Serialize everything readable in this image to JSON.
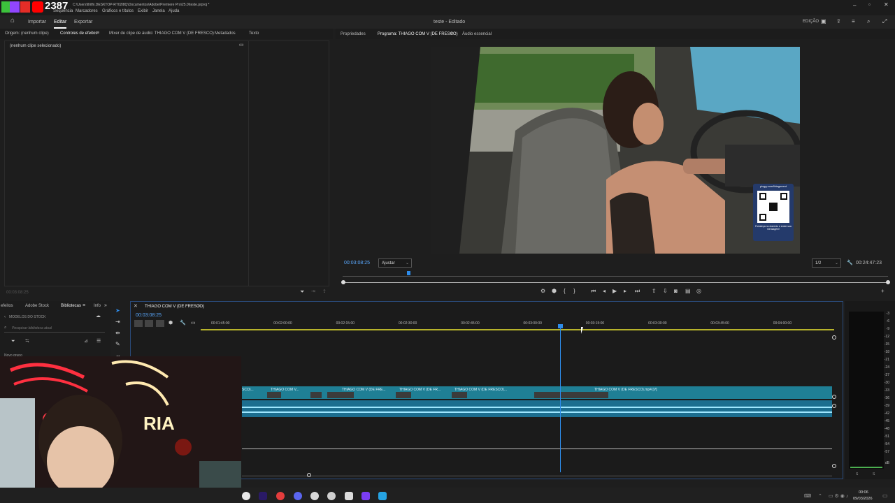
{
  "titlebar": {
    "stream_count": "2387",
    "path": "C:\\Users\\thithi.DESKTOP-RT02I8Q\\Documentos\\Adobe\\Premiere Pro\\25.0\\teste.prproj *",
    "menus": [
      "Sequência",
      "Marcadores",
      "Gráficos e títulos",
      "Exibir",
      "Janela",
      "Ajuda"
    ]
  },
  "appbar": {
    "tabs": [
      "Importar",
      "Editar",
      "Exportar"
    ],
    "active_tab": "Editar",
    "project_title": "teste - Editado",
    "workspace_label": "EDIÇÃO"
  },
  "left_panel": {
    "tabs": [
      "Origem: (nenhum clipe)",
      "Controles de efeitos",
      "Mixer de clipe de áudio: THIAGO COM V (DE FRESCO)",
      "Metadados",
      "Texto"
    ],
    "active_tab": "Controles de efeitos",
    "no_clip_text": "(nenhum clipe selecionado)",
    "timecode": "00:03:08:25"
  },
  "program": {
    "tabs": [
      "Propriedades",
      "Programa: THIAGO COM V (DE FRESCO)",
      "Áudio essencial"
    ],
    "active_tab": "Programa: THIAGO COM V (DE FRESCO)",
    "timecode": "00:03:08:25",
    "fit_value": "Ajustar",
    "resolution": "1/2",
    "duration": "00:24:47:23",
    "qr_title": "pixgg.com/thiagoeent",
    "qr_caption": "Fortaleça no domínio e envie sua mensagem!",
    "playhead_fraction": 0.12
  },
  "libraries": {
    "tabs": [
      "efeitos",
      "Adobe Stock",
      "Bibliotecas",
      "Info"
    ],
    "active_tab": "Bibliotecas",
    "section": "MODELOS DO STOCK",
    "search_placeholder": "Pesquisar biblioteca atual",
    "group": "Novo grupo"
  },
  "timeline": {
    "sequence_name": "THIAGO COM V (DE FRESCO)",
    "timecode": "00:03:08:25",
    "ruler_labels": [
      "00:01:45:00",
      "00:02:00:00",
      "00:02:15:00",
      "00:02:30:00",
      "00:02:45:00",
      "00:03:00:00",
      "00:03:15:00",
      "00:03:30:00",
      "00:03:45:00",
      "00:04:00:00"
    ],
    "clips": [
      "SCO)...",
      "THIAGO COM V...",
      "THIAGO COM V (DE FRE...",
      "THIAGO COM V (DE FR...",
      "THIAGO COM V (DE FRESCO)...",
      "THIAGO COM V (DE FRESCO).mp4 [V]"
    ]
  },
  "meters": {
    "labels": [
      "-3",
      "-6",
      "-9",
      "-12",
      "-15",
      "-18",
      "-21",
      "-24",
      "-27",
      "-30",
      "-33",
      "-36",
      "-39",
      "-42",
      "-45",
      "-48",
      "-51",
      "-54",
      "-57",
      "dB"
    ],
    "solo_labels": [
      "S",
      "S"
    ]
  },
  "taskbar": {
    "time": "00:06",
    "date": "09/03/2026"
  },
  "colors": {
    "accent": "#2d8ceb",
    "clip": "#1f7f95",
    "audio": "#1c6e8f"
  }
}
